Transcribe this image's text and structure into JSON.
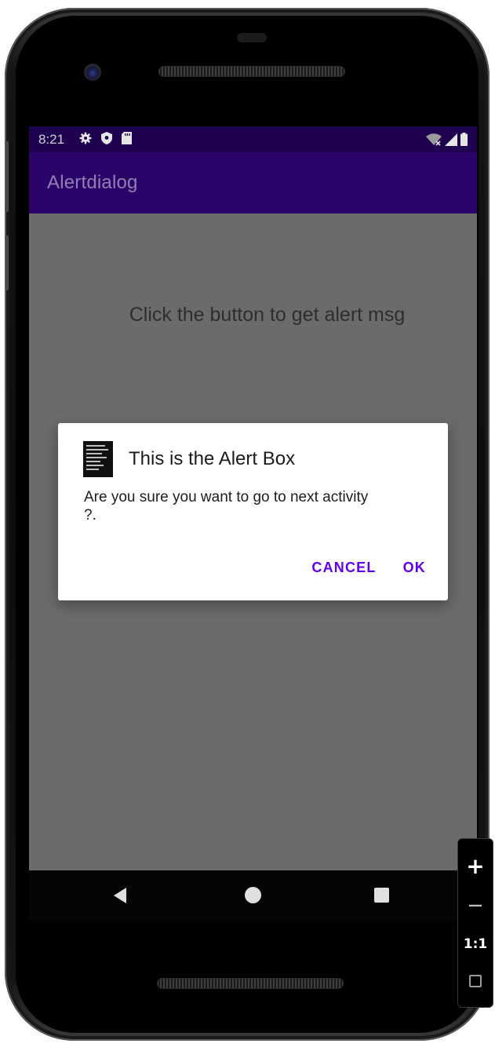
{
  "status_bar": {
    "time": "8:21",
    "left_icons": [
      "gear-icon",
      "shield-icon",
      "sd-card-icon"
    ],
    "right_icons": [
      "wifi-off-icon",
      "signal-icon",
      "battery-icon"
    ],
    "background": "#1e0250"
  },
  "app_bar": {
    "title": "Alertdialog",
    "background": "#2a0469"
  },
  "main": {
    "prompt_text": "Click the button to get alert msg"
  },
  "dialog": {
    "icon": "app-icon",
    "title": "This is the Alert Box",
    "message": "Are you sure you want to go to next activity ?.",
    "cancel_label": "CANCEL",
    "ok_label": "OK",
    "accent_color": "#6200ee"
  },
  "nav_bar": {
    "icons": [
      "back-icon",
      "home-icon",
      "recents-icon"
    ]
  },
  "zoom_panel": {
    "zoom_in_label": "+",
    "zoom_out_label": "—",
    "actual_size_label": "1:1",
    "icons": [
      "zoom-in-icon",
      "zoom-out-icon",
      "fit-screen-icon"
    ]
  }
}
